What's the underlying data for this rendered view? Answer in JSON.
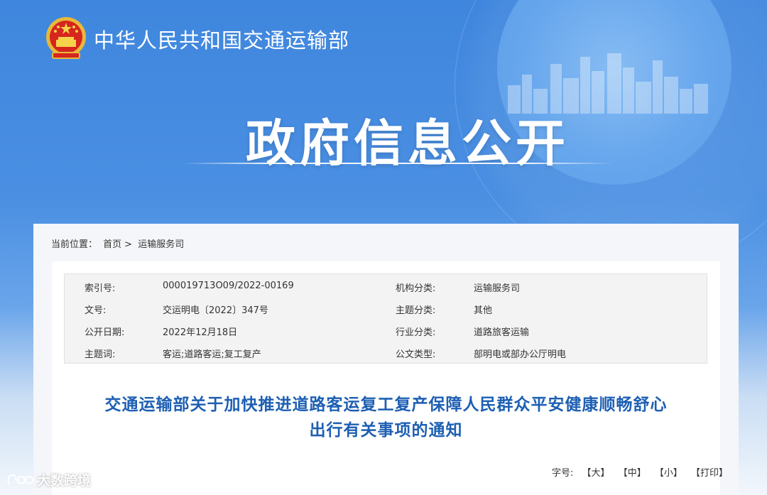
{
  "header": {
    "ministry_name": "中华人民共和国交通运输部",
    "section_title": "政府信息公开"
  },
  "breadcrumb": {
    "prefix": "当前位置：",
    "items": [
      "首页",
      "运输服务司"
    ],
    "separator": ">"
  },
  "meta": {
    "rows": [
      {
        "label1": "索引号:",
        "value1": "000019713O09/2022-00169",
        "label2": "机构分类:",
        "value2": "运输服务司"
      },
      {
        "label1": "文号:",
        "value1": "交运明电〔2022〕347号",
        "label2": "主题分类:",
        "value2": "其他"
      },
      {
        "label1": "公开日期:",
        "value1": "2022年12月18日",
        "label2": "行业分类:",
        "value2": "道路旅客运输"
      },
      {
        "label1": "主题词:",
        "value1": "客运;道路客运;复工复产",
        "label2": "公文类型:",
        "value2": "部明电或部办公厅明电"
      }
    ]
  },
  "document": {
    "title_line1": "交通运输部关于加快推进道路客运复工复产保障人民群众平安健康顺畅舒心",
    "title_line2": "出行有关事项的通知"
  },
  "font_size": {
    "label": "字号:",
    "large": "【大】",
    "medium": "【中】",
    "small": "【小】",
    "print": "【打印】"
  },
  "watermark": {
    "text": "大数跨境"
  },
  "colors": {
    "banner_blue": "#3f86de",
    "title_blue": "#1d5fb3"
  }
}
